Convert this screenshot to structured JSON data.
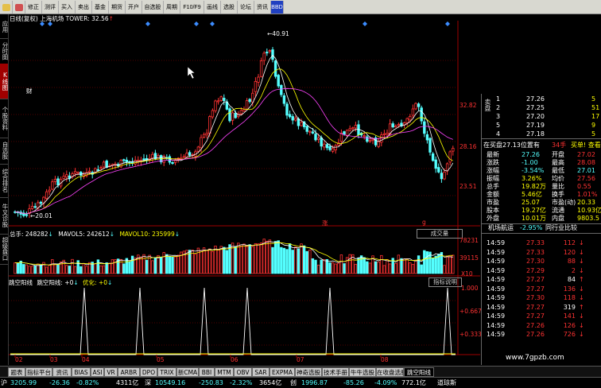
{
  "colors": {
    "up": "#ff3232",
    "down": "#54ffff",
    "yellow": "#ffff00",
    "white": "#ffffff",
    "gray": "#c0c0c0",
    "ma5": "#ffffff",
    "ma10": "#ffff00",
    "red_accent": "#ff0000"
  },
  "toolbar": {
    "items": [
      {
        "icon": "back-icon",
        "label": "",
        "color": "#e4c04a"
      },
      {
        "icon": "home-icon",
        "label": "",
        "color": "#d05050"
      },
      {
        "icon": "",
        "label": "修正"
      },
      {
        "icon": "",
        "label": "测评"
      },
      {
        "icon": "",
        "label": "买入"
      },
      {
        "icon": "",
        "label": "卖出"
      },
      {
        "icon": "",
        "label": "基金"
      },
      {
        "icon": "",
        "label": "期货"
      },
      {
        "icon": "",
        "label": "开户"
      },
      {
        "icon": "",
        "label": "自选股"
      },
      {
        "icon": "",
        "label": "周期"
      },
      {
        "icon": "",
        "label": "F10/F9"
      },
      {
        "icon": "",
        "label": "画线"
      },
      {
        "icon": "",
        "label": "选股"
      },
      {
        "icon": "",
        "label": "论坛"
      },
      {
        "icon": "",
        "label": "资讯"
      },
      {
        "icon": "",
        "label": "BBD",
        "color": "#2040c0"
      }
    ]
  },
  "left_tabs": [
    "应用",
    "分时图",
    "K线图",
    "个股资料",
    "自选股",
    "综合排名",
    "牛叉诊股",
    "超级盘口"
  ],
  "chart": {
    "title": "日线(复权) 上海机场 TOWER: 32.56",
    "title_arrow": "↑",
    "high_label": "40.91",
    "low_label": "20.01",
    "price_ticks": [
      "32.82",
      "28.16",
      "23.51"
    ],
    "month_labels": [
      "02",
      "03",
      "04",
      "05",
      "06",
      "07",
      "08"
    ],
    "markers": [
      "财",
      "涨",
      "g"
    ],
    "volume": {
      "header_label": "总手: 248282",
      "ma5": "MAVOL5: 242612",
      "ma10": "MAVOL10: 235999",
      "button": "成交量",
      "ticks": [
        "78231",
        "39115"
      ],
      "unit": "X10"
    },
    "indicator": {
      "name": "跳空阳线",
      "formula": "跳空阳线: +0",
      "opt": "优化: +0",
      "button": "指标说明",
      "ticks": [
        "1.000",
        "+0.667",
        "+0.333"
      ]
    }
  },
  "order_book": {
    "sell_label": "卖盘",
    "sell": [
      {
        "lv": "1",
        "price": "27.26",
        "vol": "5"
      },
      {
        "lv": "2",
        "price": "27.25",
        "vol": "51"
      },
      {
        "lv": "3",
        "price": "27.20",
        "vol": "17"
      },
      {
        "lv": "5",
        "price": "27.19",
        "vol": "9"
      },
      {
        "lv": "4",
        "price": "27.18",
        "vol": "5"
      }
    ],
    "strip": {
      "text": "在买盘27.13位置有",
      "amount": "34手",
      "right": "买单! 查看详细"
    }
  },
  "quote": {
    "rows": [
      [
        "最新",
        "27.26",
        "开盘",
        "27.02"
      ],
      [
        "涨跌",
        "-1.00",
        "最高",
        "28.08"
      ],
      [
        "涨幅",
        "-3.54%",
        "最低",
        "27.01"
      ],
      [
        "振幅",
        "3.26%",
        "均价",
        "27.56"
      ],
      [
        "总手",
        "19.82万",
        "量比",
        "0.55"
      ],
      [
        "金额",
        "5.46亿",
        "换手",
        "1.01%"
      ],
      [
        "市盈",
        "25.07",
        "市盈(动)",
        "20.33"
      ],
      [
        "股本",
        "19.27亿",
        "流通",
        "10.93亿"
      ],
      [
        "外盘",
        "10.01万",
        "内盘",
        "9803.5"
      ]
    ]
  },
  "industry": {
    "name": "机场航运",
    "change": "-2.95%",
    "compare": "同行业比较"
  },
  "ticks_list": [
    {
      "time": "14:59",
      "price": "27.33",
      "vol": "112",
      "dir": "down"
    },
    {
      "time": "14:59",
      "price": "27.33",
      "vol": "120",
      "dir": "down"
    },
    {
      "time": "14:59",
      "price": "27.30",
      "vol": "88",
      "dir": "down"
    },
    {
      "time": "14:59",
      "price": "27.29",
      "vol": "2",
      "dir": "down"
    },
    {
      "time": "14:59",
      "price": "27.27",
      "vol": "84",
      "dir": "up"
    },
    {
      "time": "14:59",
      "price": "27.27",
      "vol": "136",
      "dir": "down"
    },
    {
      "time": "14:59",
      "price": "27.30",
      "vol": "118",
      "dir": "down"
    },
    {
      "time": "14:59",
      "price": "27.27",
      "vol": "319",
      "dir": "up"
    },
    {
      "time": "14:59",
      "price": "27.27",
      "vol": "141",
      "dir": "down"
    },
    {
      "time": "14:59",
      "price": "27.26",
      "vol": "126",
      "dir": "down"
    },
    {
      "time": "14:59",
      "price": "27.26",
      "vol": "726",
      "dir": "down"
    }
  ],
  "watermark": "www.7gpzb.com",
  "bottom_tabs": [
    "题表",
    "指标平台",
    "资讯",
    "BIAS",
    "ASI",
    "VR",
    "ARBR",
    "DPO",
    "TRIX",
    "新CMA",
    "BBI",
    "MTM",
    "OBV",
    "SAR",
    "EXPMA",
    "神奇选股",
    "技术手册",
    "牛牛选股",
    "在收盘选股",
    "跳空阳线"
  ],
  "active_bottom_tab": 19,
  "statusbar": {
    "segments": [
      {
        "t": "沪",
        "c": "#fff"
      },
      {
        "t": "3205.99",
        "c": "#54ffff"
      },
      {
        "t": "-26.36",
        "c": "#54ffff"
      },
      {
        "t": "-0.82%",
        "c": "#54ffff"
      },
      {
        "t": "4311亿",
        "c": "#fff"
      },
      {
        "t": "深",
        "c": "#fff"
      },
      {
        "t": "10549.16",
        "c": "#54ffff"
      },
      {
        "t": "-250.83",
        "c": "#54ffff"
      },
      {
        "t": "-2.32%",
        "c": "#54ffff"
      },
      {
        "t": "3654亿",
        "c": "#fff"
      },
      {
        "t": "创",
        "c": "#fff"
      },
      {
        "t": "1996.87",
        "c": "#54ffff"
      },
      {
        "t": "-85.26",
        "c": "#54ffff"
      },
      {
        "t": "-4.09%",
        "c": "#54ffff"
      },
      {
        "t": "772.1亿",
        "c": "#fff"
      },
      {
        "t": "道琼斯",
        "c": "#fff"
      }
    ]
  }
}
